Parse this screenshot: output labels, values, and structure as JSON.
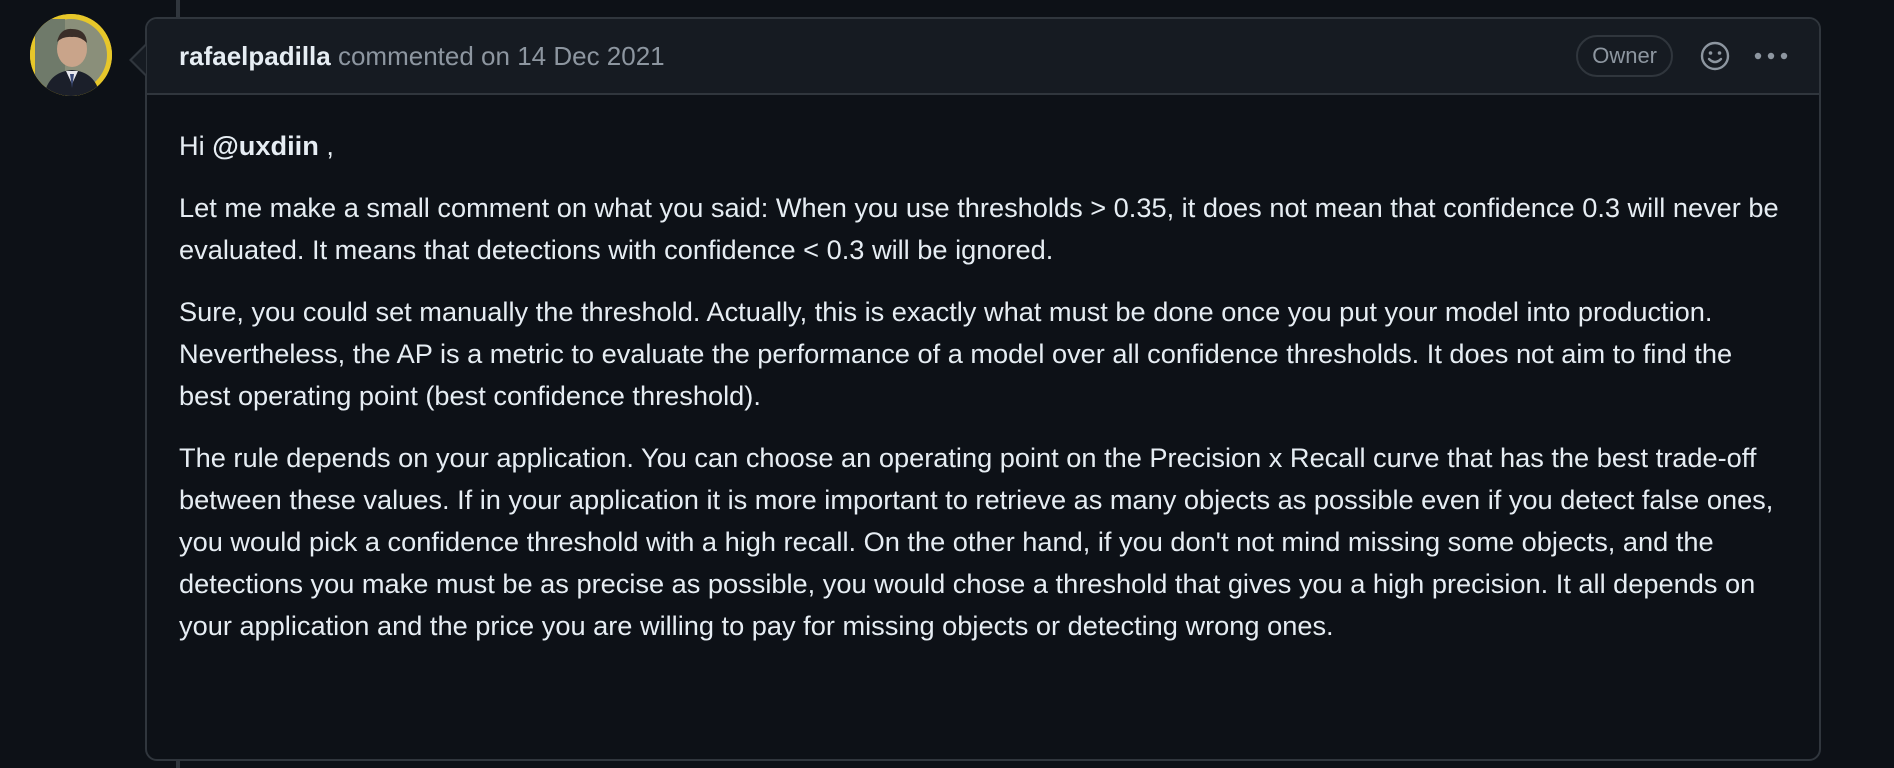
{
  "comment": {
    "author": "rafaelpadilla",
    "action": "commented on",
    "date": "14 Dec 2021",
    "badge": "Owner",
    "icons": {
      "reaction": "smiley-icon",
      "menu": "kebab-horizontal-icon"
    },
    "body": {
      "greeting_prefix": "Hi",
      "mention": "@uxdiin",
      "greeting_suffix": ",",
      "paragraphs": [
        "Let me make a small comment on what you said: When you use thresholds > 0.35, it does not mean that confidence 0.3 will never be evaluated. It means that detections with confidence < 0.3 will be ignored.",
        "Sure, you could set manually the threshold. Actually, this is exactly what must be done once you put your model into production. Nevertheless, the AP is a metric to evaluate the performance of a model over all confidence thresholds. It does not aim to find the best operating point (best confidence threshold).",
        "The rule depends on your application. You can choose an operating point on the Precision x Recall curve that has the best trade-off between these values. If in your application it is more important to retrieve as many objects as possible even if you detect false ones, you would pick a confidence threshold with a high recall. On the other hand, if you don't not mind missing some objects, and the detections you make must be as precise as possible, you would chose a threshold that gives you a high precision. It all depends on your application and the price you are willing to pay for missing objects or detecting wrong ones."
      ]
    }
  },
  "colors": {
    "background": "#0d1117",
    "header_background": "#161b22",
    "border": "#30363d",
    "text": "#e6edf3",
    "muted_text": "#8d96a0",
    "avatar_ring": "#e7c72a"
  }
}
